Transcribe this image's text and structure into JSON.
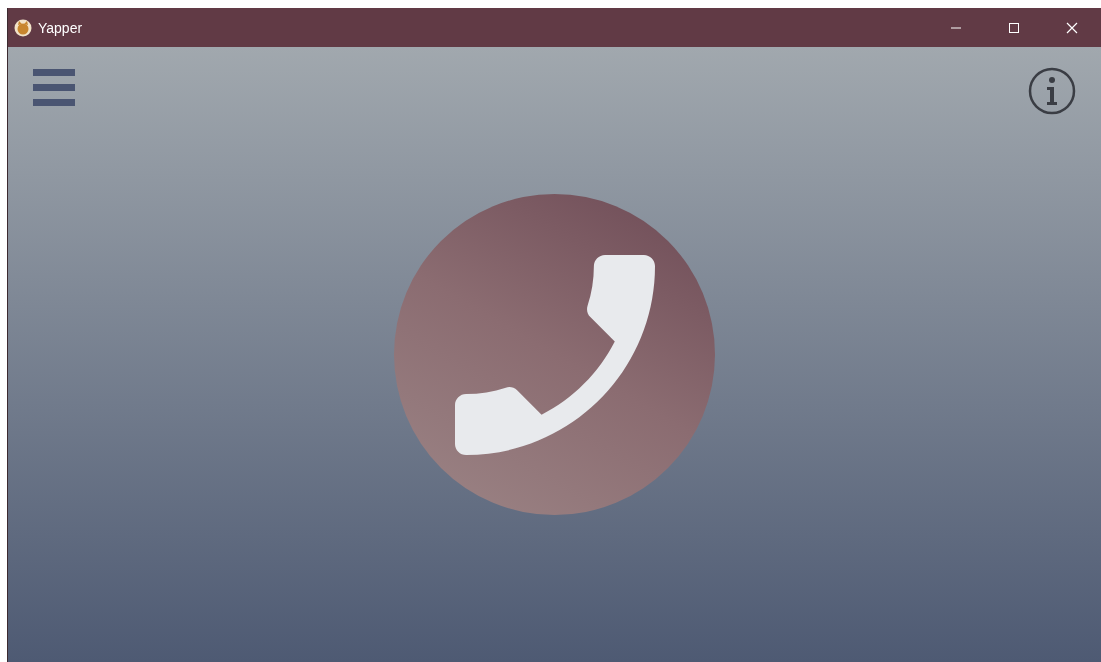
{
  "window": {
    "title": "Yapper"
  }
}
